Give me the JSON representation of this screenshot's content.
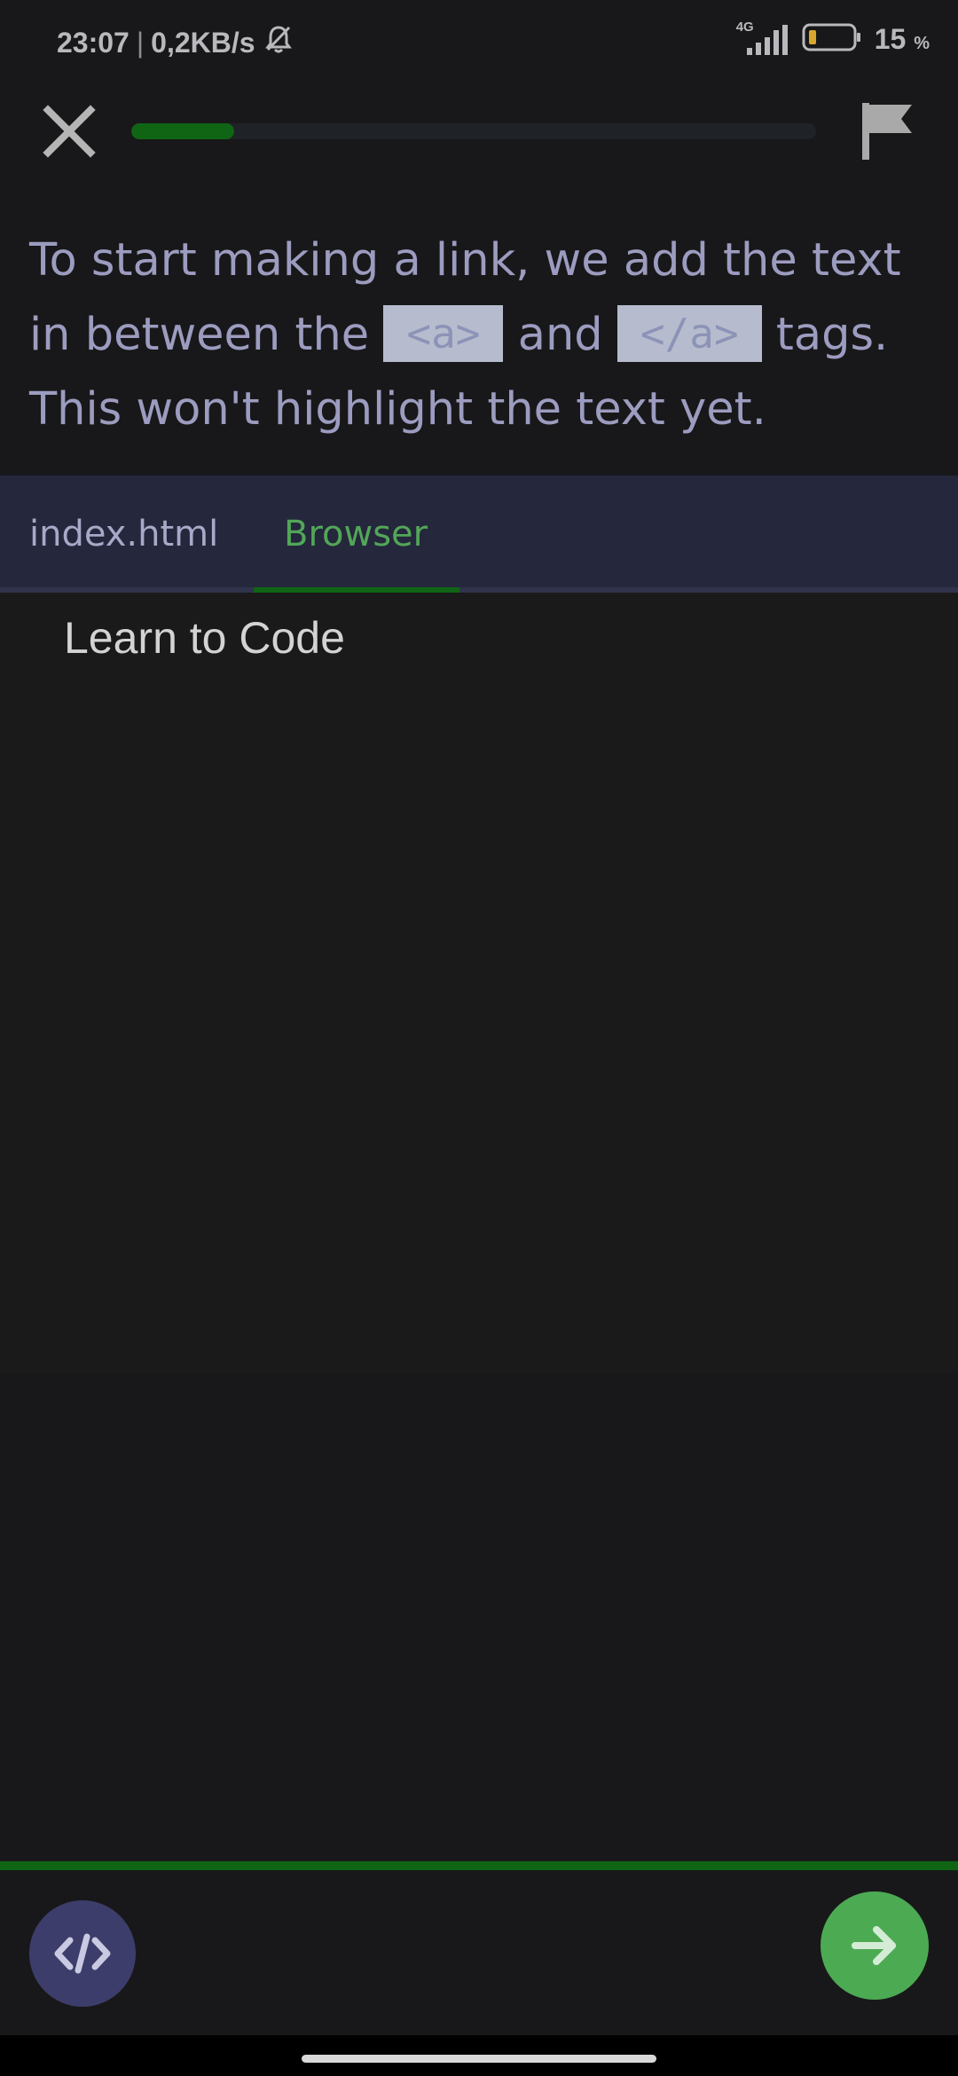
{
  "status_bar": {
    "time": "23:07",
    "separator": "|",
    "net_speed": "0,2KB/s",
    "network_type": "4G",
    "battery_percent": "15",
    "battery_unit": "%",
    "icons": [
      "alarm-off-icon",
      "signal-icon",
      "battery-icon"
    ]
  },
  "lesson": {
    "progress": 0.15,
    "close_icon": "close-icon",
    "flag_icon": "flag-icon"
  },
  "instruction": {
    "part1": "To start making a link, we add the text in between the",
    "code1": "<a>",
    "part2": "and",
    "code2": "</a>",
    "part3": "tags. This won't highlight the text yet."
  },
  "tabs": [
    {
      "label": "index.html",
      "active": false
    },
    {
      "label": "Browser",
      "active": true
    }
  ],
  "browser": {
    "content": "Learn to Code"
  },
  "bottom": {
    "code_button_icon": "code-icon",
    "next_button_icon": "arrow-right-icon"
  },
  "colors": {
    "accent_green": "#4caa53",
    "progress_green": "#0f6514",
    "tab_bg": "#25273c",
    "code_button_bg": "#3d3d6b"
  }
}
